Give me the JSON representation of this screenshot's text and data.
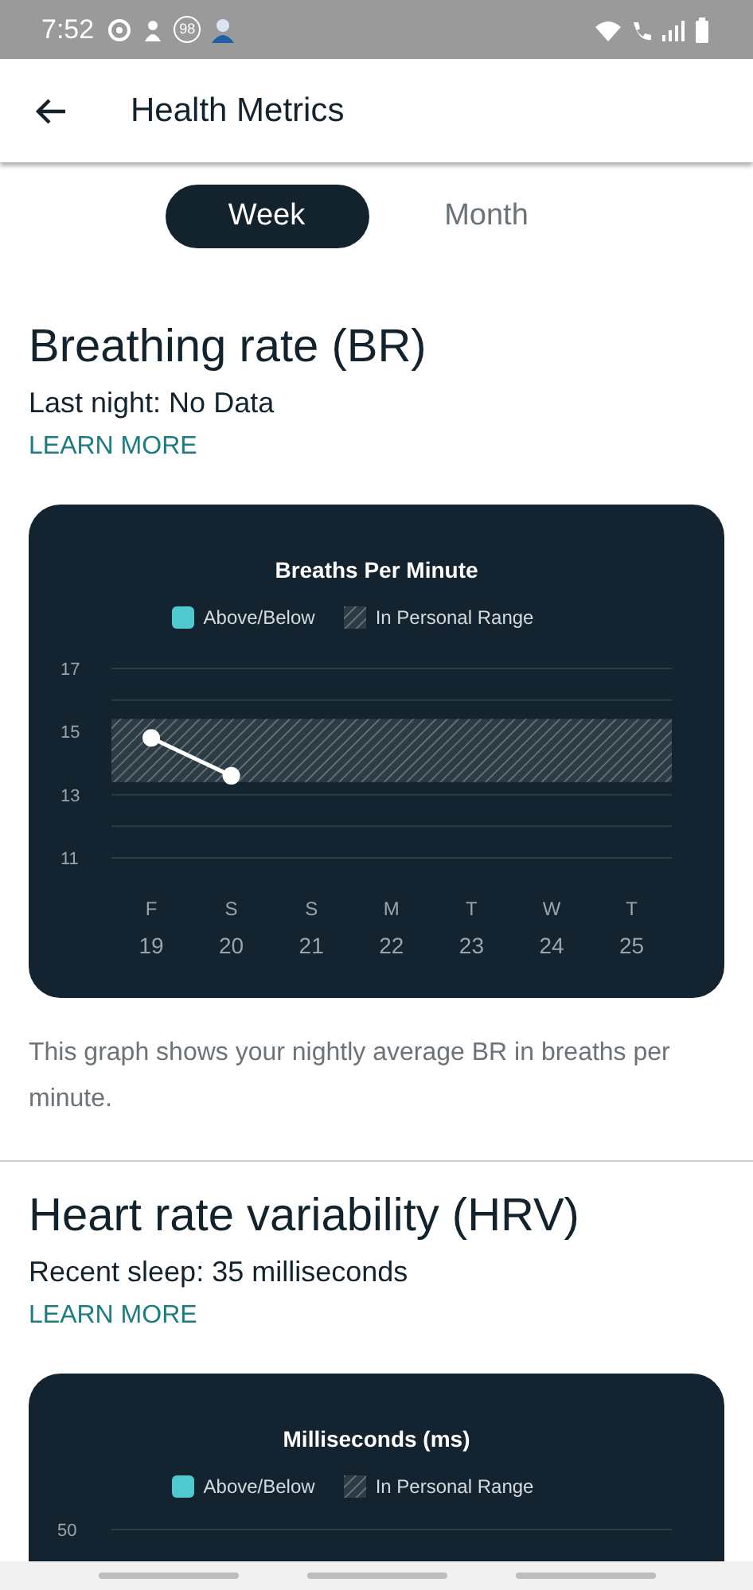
{
  "status_bar": {
    "time": "7:52",
    "notification_badge": "98"
  },
  "app_bar": {
    "title": "Health Metrics"
  },
  "tabs": [
    {
      "label": "Week",
      "selected": true
    },
    {
      "label": "Month",
      "selected": false
    }
  ],
  "sections": [
    {
      "title": "Breathing rate (BR)",
      "summary": "Last night: No Data",
      "link": "LEARN MORE",
      "legend": [
        {
          "kind": "swatch",
          "label": "Above/Below",
          "color": "#4fc9cf"
        },
        {
          "kind": "hatch",
          "label": "In Personal Range"
        }
      ],
      "weekdays": [
        "F",
        "S",
        "S",
        "M",
        "T",
        "W",
        "T"
      ],
      "chart_data": {
        "type": "line",
        "title": "Breaths Per Minute",
        "categories": [
          "19",
          "20",
          "21",
          "22",
          "23",
          "24",
          "25"
        ],
        "ylim": [
          11,
          17
        ],
        "yticks": [
          11,
          13,
          15,
          17
        ],
        "series": [
          {
            "color": "#ffffff",
            "marker": "o",
            "values": [
              14.8,
              13.6,
              null,
              null,
              null,
              null,
              null
            ]
          }
        ],
        "bands": [
          {
            "axis": "y",
            "from": 13.4,
            "to": 15.4
          }
        ]
      },
      "caption": "This graph shows your nightly average BR in breaths per minute."
    },
    {
      "title": "Heart rate variability (HRV)",
      "summary": "Recent sleep: 35 milliseconds",
      "link": "LEARN MORE",
      "legend": [
        {
          "kind": "swatch",
          "label": "Above/Below",
          "color": "#4fc9cf"
        },
        {
          "kind": "hatch",
          "label": "In Personal Range"
        }
      ],
      "chart_title": "Milliseconds (ms)",
      "y_tick_label": "50"
    }
  ]
}
